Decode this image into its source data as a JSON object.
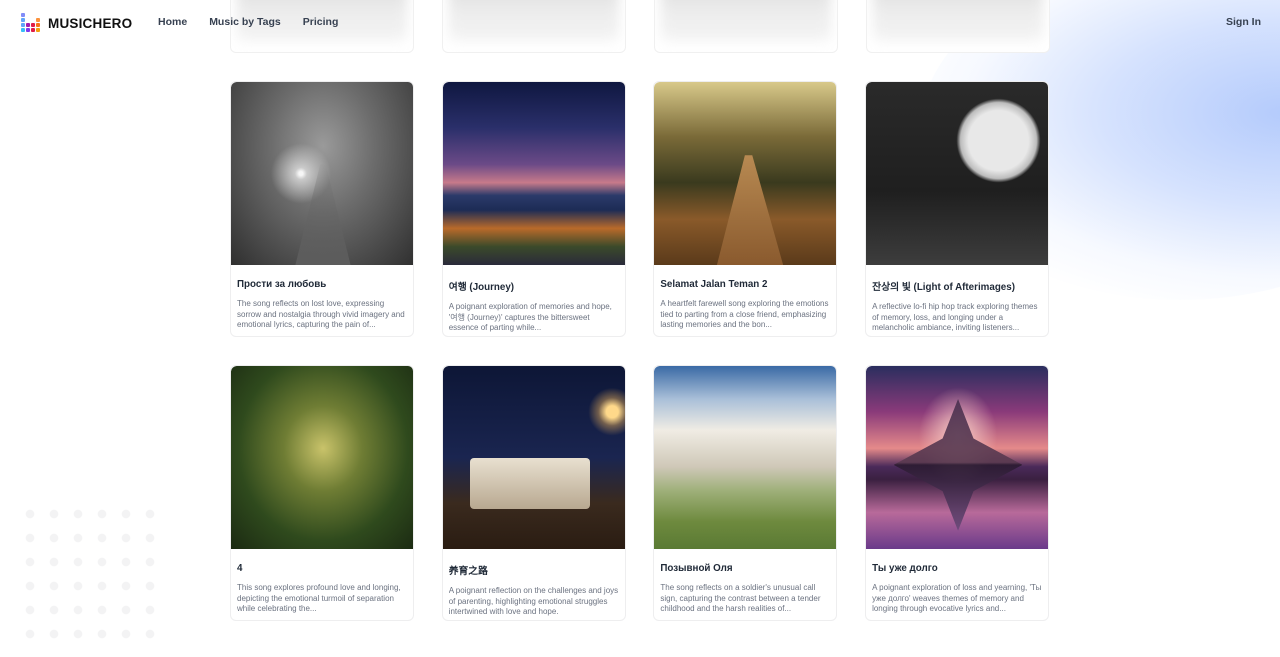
{
  "brand": {
    "name": "MUSICHERO",
    "logo_colors": [
      "#6366f1",
      "#60a5fa",
      "#38bdf8",
      "#a21caf",
      "#e11d48",
      "#f97316",
      "#f59e0b"
    ]
  },
  "nav": {
    "items": [
      {
        "label": "Home"
      },
      {
        "label": "Music by Tags"
      },
      {
        "label": "Pricing"
      }
    ],
    "sign_in": "Sign In"
  },
  "songs": [
    {
      "title": "Прости за любовь",
      "description": "The song reflects on lost love, expressing sorrow and nostalgia through vivid imagery and emotional lyrics, capturing the pain of...",
      "art": "misty-forest-path"
    },
    {
      "title": "여행 (Journey)",
      "description": "A poignant exploration of memories and hope, '여행 (Journey)' captures the bittersweet essence of parting while...",
      "art": "night-lake-autumn"
    },
    {
      "title": "Selamat Jalan Teman 2",
      "description": "A heartfelt farewell song exploring the emotions tied to parting from a close friend, emphasizing lasting memories and the bon...",
      "art": "sunlit-forest-path"
    },
    {
      "title": "잔상의 빛 (Light of Afterimages)",
      "description": "A reflective lo-fi hip hop track exploring themes of memory, loss, and longing under a melancholic ambiance, inviting listeners...",
      "art": "full-moon-tree"
    },
    {
      "title": "4",
      "description": "This song explores profound love and longing, depicting the emotional turmoil of separation while celebrating the...",
      "art": "great-oak-tree"
    },
    {
      "title": "养育之路",
      "description": "A poignant reflection on the challenges and joys of parenting, highlighting emotional struggles intertwined with love and hope.",
      "art": "night-crib-lantern"
    },
    {
      "title": "Позывной Оля",
      "description": "The song reflects on a soldier's unusual call sign, capturing the contrast between a tender childhood and the harsh realities of...",
      "art": "cloudy-meadow"
    },
    {
      "title": "Ты уже долго",
      "description": "A poignant exploration of loss and yearning, 'Ты уже долго' weaves themes of memory and longing through evocative lyrics and...",
      "art": "galaxy-mountain-reflection"
    }
  ]
}
